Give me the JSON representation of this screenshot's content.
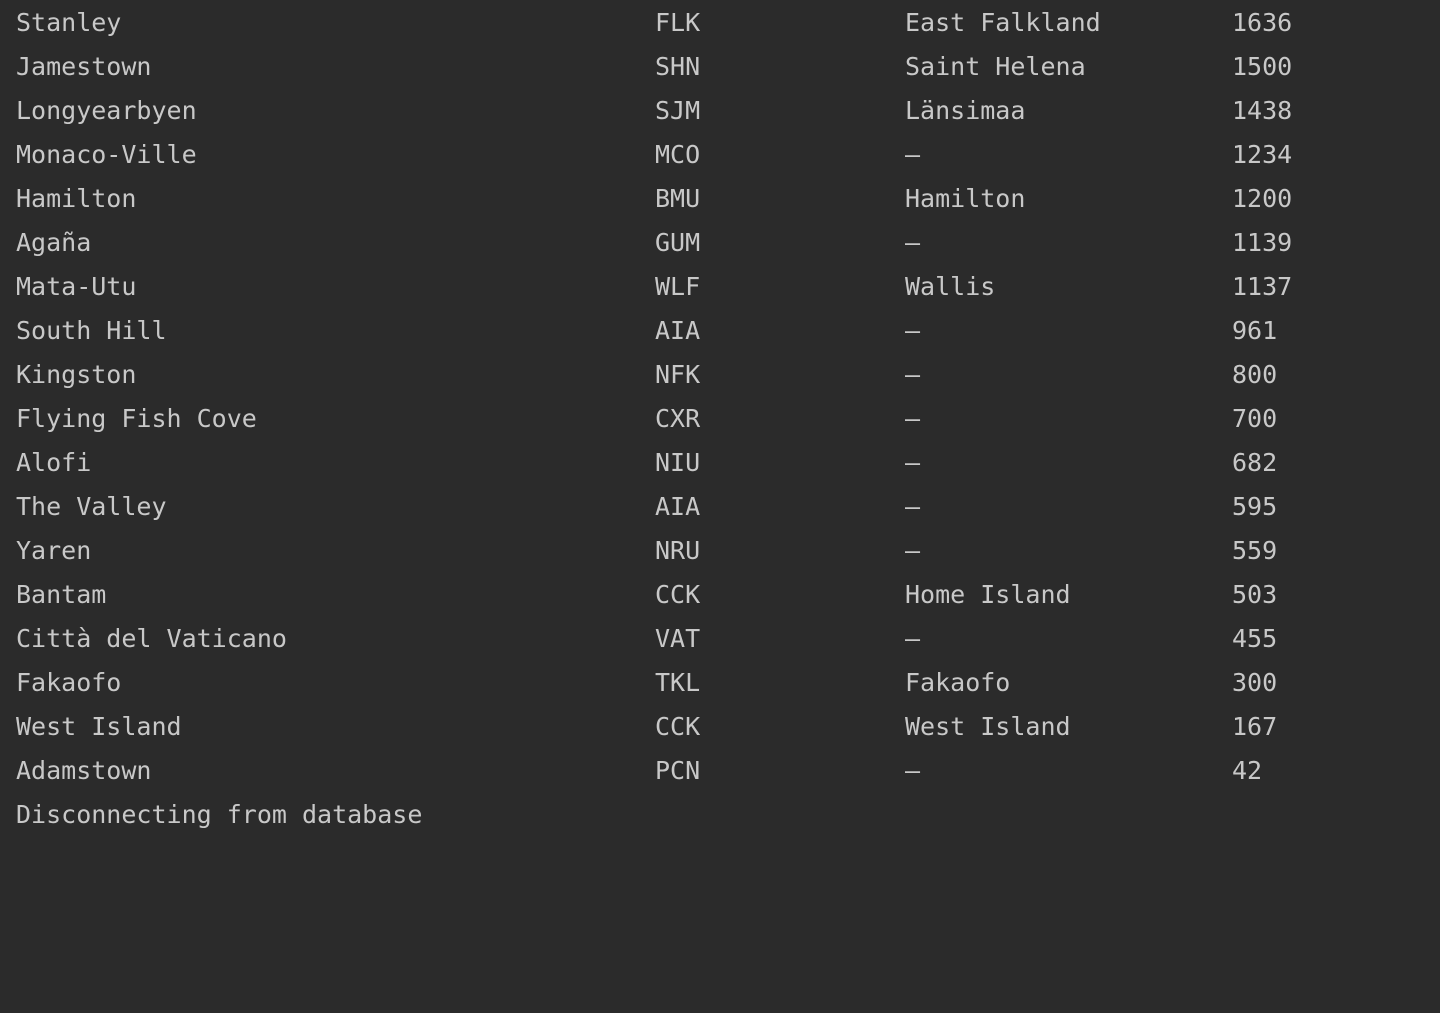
{
  "console": {
    "rows": [
      {
        "city": "Stanley",
        "code": "FLK",
        "district": "East Falkland",
        "population": "1636"
      },
      {
        "city": "Jamestown",
        "code": "SHN",
        "district": "Saint Helena",
        "population": "1500"
      },
      {
        "city": "Longyearbyen",
        "code": "SJM",
        "district": "Länsimaa",
        "population": "1438"
      },
      {
        "city": "Monaco-Ville",
        "code": "MCO",
        "district": "–",
        "population": "1234"
      },
      {
        "city": "Hamilton",
        "code": "BMU",
        "district": "Hamilton",
        "population": "1200"
      },
      {
        "city": "Agaña",
        "code": "GUM",
        "district": "–",
        "population": "1139"
      },
      {
        "city": "Mata-Utu",
        "code": "WLF",
        "district": "Wallis",
        "population": "1137"
      },
      {
        "city": "South Hill",
        "code": "AIA",
        "district": "–",
        "population": "961"
      },
      {
        "city": "Kingston",
        "code": "NFK",
        "district": "–",
        "population": "800"
      },
      {
        "city": "Flying Fish Cove",
        "code": "CXR",
        "district": "–",
        "population": "700"
      },
      {
        "city": "Alofi",
        "code": "NIU",
        "district": "–",
        "population": "682"
      },
      {
        "city": "The Valley",
        "code": "AIA",
        "district": "–",
        "population": "595"
      },
      {
        "city": "Yaren",
        "code": "NRU",
        "district": "–",
        "population": "559"
      },
      {
        "city": "Bantam",
        "code": "CCK",
        "district": "Home Island",
        "population": "503"
      },
      {
        "city": "Città del Vaticano",
        "code": "VAT",
        "district": "–",
        "population": "455"
      },
      {
        "city": "Fakaofo",
        "code": "TKL",
        "district": "Fakaofo",
        "population": "300"
      },
      {
        "city": "West Island",
        "code": "CCK",
        "district": "West Island",
        "population": "167"
      },
      {
        "city": "Adamstown",
        "code": "PCN",
        "district": "–",
        "population": "42"
      }
    ],
    "footer": "Disconnecting from database"
  },
  "colors": {
    "background": "#2b2b2b",
    "text": "#c8c8c8"
  }
}
